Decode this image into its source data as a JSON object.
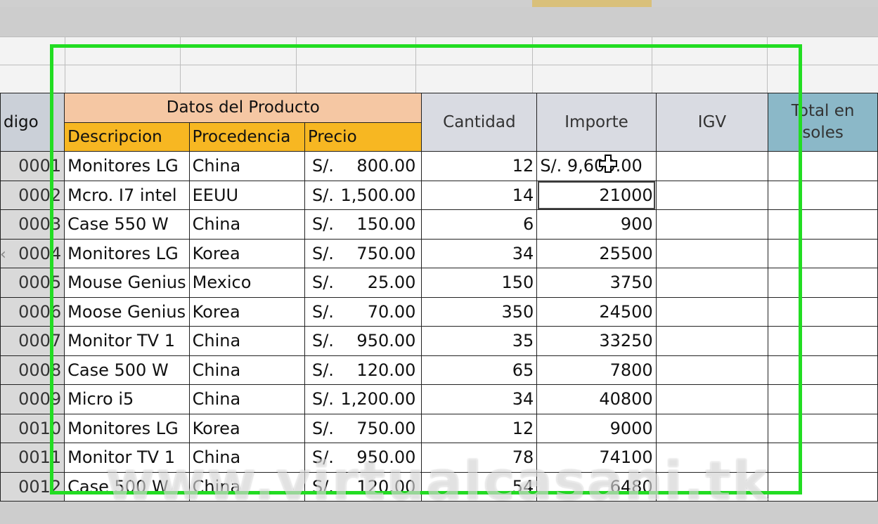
{
  "headers": {
    "code": "digo",
    "group": "Datos del Producto",
    "descripcion": "Descripcion",
    "procedencia": "Procedencia",
    "precio": "Precio",
    "cantidad": "Cantidad",
    "importe": "Importe",
    "igv": "IGV",
    "total_line1": "Total en",
    "total_line2": "soles"
  },
  "currency": "S/.",
  "rows": [
    {
      "code": "0001",
      "desc": "Monitores LG",
      "origin": "China",
      "price": "800.00",
      "qty": "12",
      "importe": "S/. 9,600.00"
    },
    {
      "code": "0002",
      "desc": "Mcro. I7 intel",
      "origin": "EEUU",
      "price": "1,500.00",
      "qty": "14",
      "importe": "21000"
    },
    {
      "code": "0003",
      "desc": "Case 550 W",
      "origin": "China",
      "price": "150.00",
      "qty": "6",
      "importe": "900"
    },
    {
      "code": "0004",
      "desc": "Monitores LG",
      "origin": "Korea",
      "price": "750.00",
      "qty": "34",
      "importe": "25500"
    },
    {
      "code": "0005",
      "desc": "Mouse Genius",
      "origin": "Mexico",
      "price": "25.00",
      "qty": "150",
      "importe": "3750"
    },
    {
      "code": "0006",
      "desc": "Moose Genius",
      "origin": "Korea",
      "price": "70.00",
      "qty": "350",
      "importe": "24500"
    },
    {
      "code": "0007",
      "desc": "Monitor TV 1",
      "origin": "China",
      "price": "950.00",
      "qty": "35",
      "importe": "33250"
    },
    {
      "code": "0008",
      "desc": "Case 500 W",
      "origin": "China",
      "price": "120.00",
      "qty": "65",
      "importe": "7800"
    },
    {
      "code": "0009",
      "desc": "Micro i5",
      "origin": "China",
      "price": "1,200.00",
      "qty": "34",
      "importe": "40800"
    },
    {
      "code": "0010",
      "desc": "Monitores LG",
      "origin": "Korea",
      "price": "750.00",
      "qty": "12",
      "importe": "9000"
    },
    {
      "code": "0011",
      "desc": "Monitor TV 1",
      "origin": "China",
      "price": "950.00",
      "qty": "78",
      "importe": "74100"
    },
    {
      "code": "0012",
      "desc": "Case 500 W",
      "origin": "China",
      "price": "120.00",
      "qty": "54",
      "importe": "6480"
    }
  ],
  "watermark": "www.virtualcasani.tk",
  "colors": {
    "frame": "#22dd22",
    "group_header": "#f5c7a3",
    "sub_header": "#f7b722",
    "total_header": "#8bb8c8"
  }
}
